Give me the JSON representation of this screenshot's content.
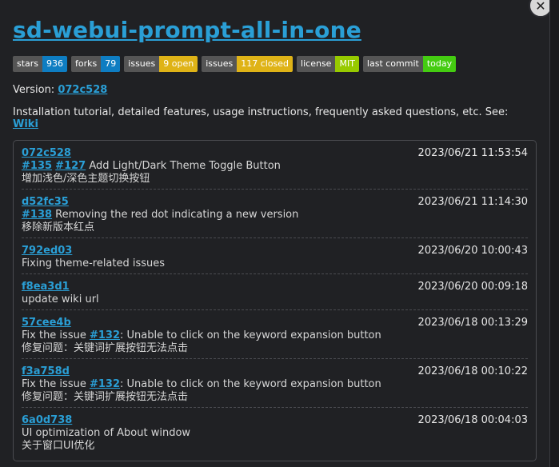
{
  "title": "sd-webui-prompt-all-in-one",
  "badges": [
    {
      "key": "stars",
      "value": "936",
      "color": "#0e7dc2"
    },
    {
      "key": "forks",
      "value": "79",
      "color": "#0e7dc2"
    },
    {
      "key": "issues",
      "value": "9 open",
      "color": "#dfb317"
    },
    {
      "key": "issues",
      "value": "117 closed",
      "color": "#dfb317"
    },
    {
      "key": "license",
      "value": "MIT",
      "color": "#97ca00"
    },
    {
      "key": "last commit",
      "value": "today",
      "color": "#4c1"
    }
  ],
  "version": {
    "label": "Version: ",
    "value": "072c528"
  },
  "install": {
    "text": "Installation tutorial, detailed features, usage instructions, frequently asked questions, etc. See: ",
    "link": "Wiki"
  },
  "commits": [
    {
      "hash": "072c528",
      "date": "2023/06/21 11:53:54",
      "lines": [
        [
          {
            "link": "#135"
          },
          {
            "text": " "
          },
          {
            "link": "#127"
          },
          {
            "text": " Add Light/Dark Theme Toggle Button"
          }
        ],
        [
          {
            "text": "增加浅色/深色主题切换按钮"
          }
        ]
      ]
    },
    {
      "hash": "d52fc35",
      "date": "2023/06/21 11:14:30",
      "lines": [
        [
          {
            "link": "#138"
          },
          {
            "text": " Removing the red dot indicating a new version"
          }
        ],
        [
          {
            "text": "移除新版本红点"
          }
        ]
      ]
    },
    {
      "hash": "792ed03",
      "date": "2023/06/20 10:00:43",
      "lines": [
        [
          {
            "text": "Fixing theme-related issues"
          }
        ]
      ]
    },
    {
      "hash": "f8ea3d1",
      "date": "2023/06/20 00:09:18",
      "lines": [
        [
          {
            "text": "update wiki url"
          }
        ]
      ]
    },
    {
      "hash": "57cee4b",
      "date": "2023/06/18 00:13:29",
      "lines": [
        [
          {
            "text": "Fix the issue "
          },
          {
            "link": "#132"
          },
          {
            "text": ": Unable to click on the keyword expansion button"
          }
        ],
        [
          {
            "text": "修复问题：关键词扩展按钮无法点击"
          }
        ]
      ]
    },
    {
      "hash": "f3a758d",
      "date": "2023/06/18 00:10:22",
      "lines": [
        [
          {
            "text": "Fix the issue "
          },
          {
            "link": "#132"
          },
          {
            "text": ": Unable to click on the keyword expansion button"
          }
        ],
        [
          {
            "text": "修复问题：关键词扩展按钮无法点击"
          }
        ]
      ]
    },
    {
      "hash": "6a0d738",
      "date": "2023/06/18 00:04:03",
      "lines": [
        [
          {
            "text": "UI optimization of About window"
          }
        ],
        [
          {
            "text": "关于窗口UI优化"
          }
        ]
      ]
    }
  ],
  "close_icon": "close-icon"
}
